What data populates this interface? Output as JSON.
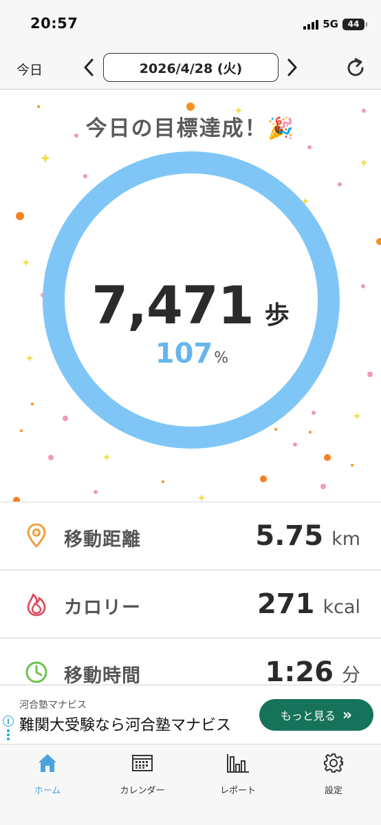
{
  "status_bar": {
    "time": "20:57",
    "network": "5G",
    "battery": "44"
  },
  "nav": {
    "today_label": "今日",
    "date": "2026/4/28 (火)",
    "prev_icon": "chevron-left-icon",
    "next_icon": "chevron-right-icon",
    "refresh_icon": "refresh-icon"
  },
  "hero": {
    "title": "今日の目標達成！🎉",
    "steps": "7,471",
    "steps_unit": "歩",
    "percent": "107",
    "percent_unit": "%",
    "goal_fraction": 1.0,
    "ring_color": "#7fc6f7"
  },
  "stats": [
    {
      "label": "移動距離",
      "value": "5.75",
      "unit": "km",
      "icon": "location-pin-icon",
      "icon_color": "#f0a040"
    },
    {
      "label": "カロリー",
      "value": "271",
      "unit": "kcal",
      "icon": "flame-icon",
      "icon_color": "#e04b5f"
    },
    {
      "label": "移動時間",
      "value": "1:26",
      "unit": "分",
      "icon": "clock-icon",
      "icon_color": "#6cc24a"
    }
  ],
  "ad": {
    "advertiser": "河合塾マナビス",
    "headline": "難関大受験なら河合塾マナビス",
    "cta": "もっと見る",
    "cta_arrow": "»",
    "info": "i",
    "cta_color": "#16735a"
  },
  "tabs": [
    {
      "label": "ホーム",
      "icon": "home-icon",
      "active": true
    },
    {
      "label": "カレンダー",
      "icon": "calendar-icon",
      "active": false
    },
    {
      "label": "レポート",
      "icon": "bar-chart-icon",
      "active": false
    },
    {
      "label": "設定",
      "icon": "gear-icon",
      "active": false
    }
  ],
  "colors": {
    "accent": "#4aa3e0",
    "percent": "#66b6ec"
  }
}
